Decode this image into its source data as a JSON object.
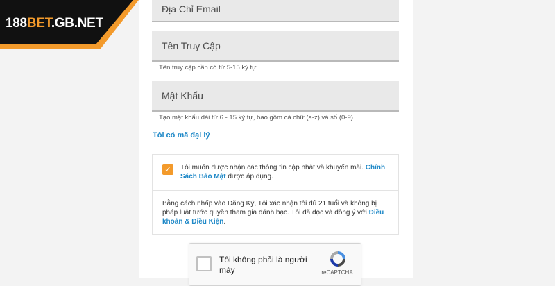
{
  "brand": {
    "prefix": "188",
    "highlight": "BET",
    "suffix": ".GB.NET",
    "accent_color": "#f39a2b",
    "dark_color": "#111111"
  },
  "form": {
    "email": {
      "placeholder": "Địa Chỉ Email",
      "value": ""
    },
    "username": {
      "placeholder": "Tên Truy Cập",
      "value": "",
      "hint": "Tên truy cập cần có từ 5-15 ký tự."
    },
    "password": {
      "placeholder": "Mật Khẩu",
      "value": "",
      "hint": "Tạo mật khẩu dài từ 6 - 15 ký tự, bao gồm cả chữ (a-z) và số (0-9)."
    },
    "agent_link": "Tôi có mã đại lý"
  },
  "consent": {
    "checked": true,
    "text_before": "Tôi muốn được nhận các thông tin cập nhật và khuyến mãi.",
    "privacy_link": "Chính Sách Bảo Mật",
    "text_after": "được áp dụng.",
    "terms_before": "Bằng cách nhấp vào Đăng Ký, Tôi xác nhận tôi đủ 21 tuổi và không bị pháp luật tước quyền tham gia đánh bạc. Tôi đã đọc và đồng ý với",
    "terms_link": "Điều khoản & Điều Kiện",
    "terms_after": "."
  },
  "recaptcha": {
    "label": "Tôi không phải là người máy",
    "brand": "reCAPTCHA",
    "checked": false
  },
  "colors": {
    "link": "#1e88c7",
    "checkbox": "#f39a2b",
    "field_bg": "#e9e9e9"
  }
}
